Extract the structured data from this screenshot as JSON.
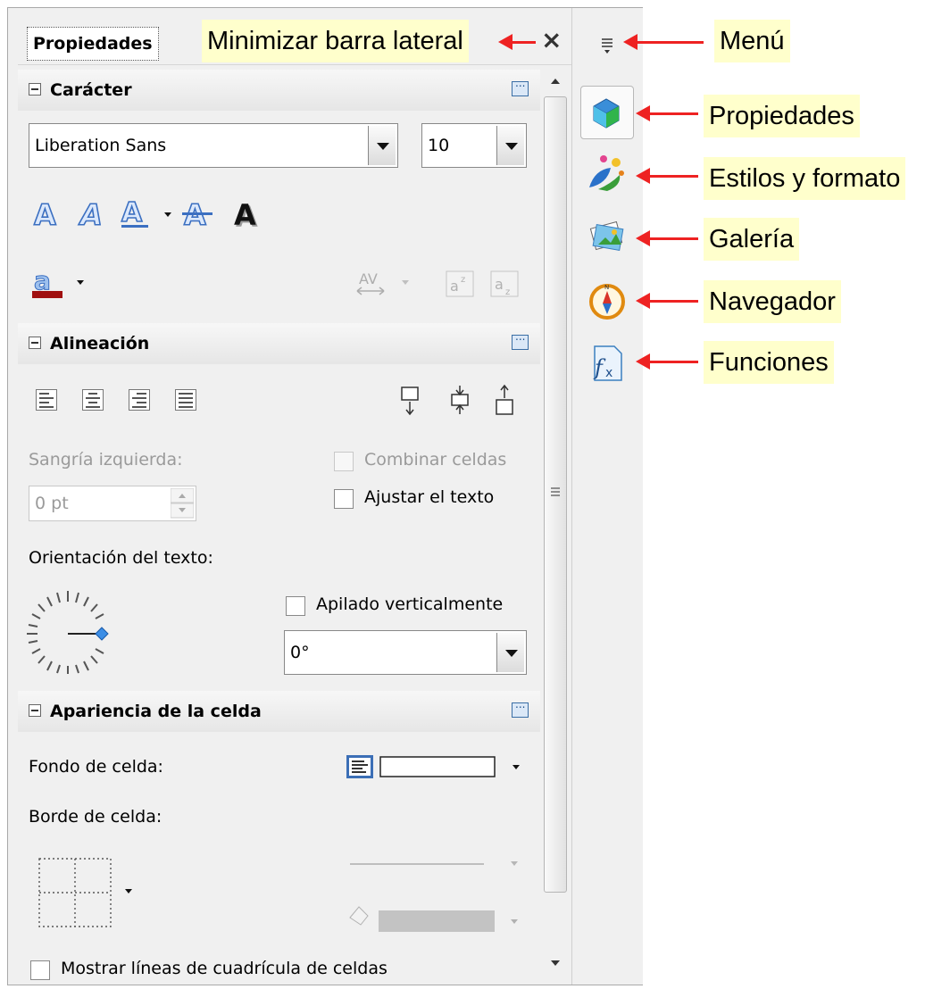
{
  "sidebar": {
    "tab_title": "Propiedades",
    "close_symbol": "×",
    "sections": {
      "caracter": {
        "title": "Carácter",
        "font_name": "Liberation Sans",
        "font_size": "10"
      },
      "alineacion": {
        "title": "Alineación",
        "indent_label": "Sangría izquierda:",
        "indent_value": "0 pt",
        "merge_label": "Combinar celdas",
        "wrap_label": "Ajustar el texto",
        "orientation_label": "Orientación del texto:",
        "stacked_label": "Apilado verticalmente",
        "angle_value": "0°"
      },
      "apariencia": {
        "title": "Apariencia de la celda",
        "background_label": "Fondo de celda:",
        "border_label": "Borde de celda:",
        "gridlines_label": "Mostrar líneas de cuadrícula de celdas"
      }
    }
  },
  "callouts": {
    "minimize": "Minimizar barra lateral",
    "menu": "Menú",
    "properties": "Propiedades",
    "styles": "Estilos y formato",
    "gallery": "Galería",
    "navigator": "Navegador",
    "functions": "Funciones"
  },
  "colors": {
    "callout_bg": "#ffffcc",
    "arrow": "#ee2222",
    "accent": "#3a6ea5"
  }
}
